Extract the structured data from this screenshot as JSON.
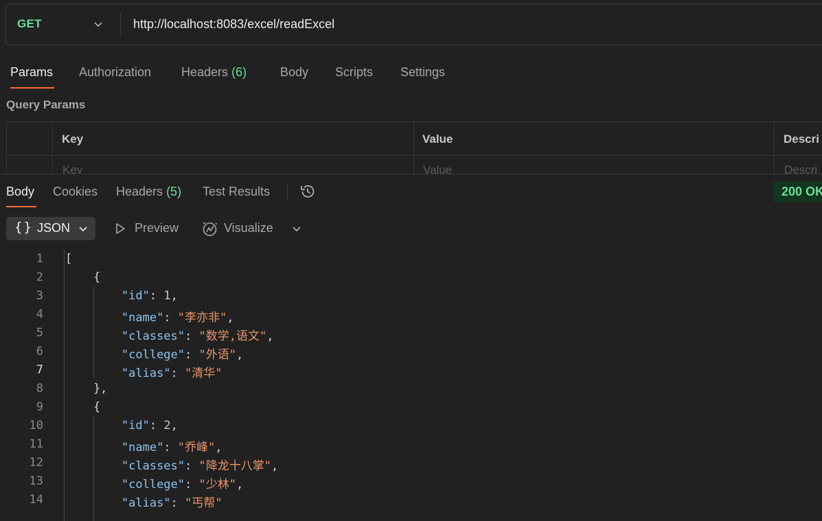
{
  "request": {
    "method": "GET",
    "url": "http://localhost:8083/excel/readExcel"
  },
  "request_tabs": {
    "params": "Params",
    "authorization": "Authorization",
    "headers": "Headers",
    "headers_count": "(6)",
    "body": "Body",
    "scripts": "Scripts",
    "settings": "Settings"
  },
  "query_params": {
    "title": "Query Params",
    "columns": {
      "key": "Key",
      "value": "Value",
      "description": "Descri"
    },
    "placeholders": {
      "key": "Key",
      "value": "Value",
      "description": "Descri"
    }
  },
  "response_tabs": {
    "body": "Body",
    "cookies": "Cookies",
    "headers": "Headers",
    "headers_count": "(5)",
    "test_results": "Test Results"
  },
  "status": {
    "text": "200 OK",
    "color": "#6bdd9a"
  },
  "format_bar": {
    "format_brace": "{}",
    "format_label": "JSON",
    "preview": "Preview",
    "visualize": "Visualize"
  },
  "accent_color": "#ff6c37",
  "response_lines": [
    {
      "n": "1",
      "text": "["
    },
    {
      "n": "2",
      "text": "    {"
    },
    {
      "n": "3",
      "key": "\"id\"",
      "sep": ": ",
      "num": "1",
      "end": ","
    },
    {
      "n": "4",
      "key": "\"name\"",
      "sep": ": ",
      "str": "\"李亦非\"",
      "end": ","
    },
    {
      "n": "5",
      "key": "\"classes\"",
      "sep": ": ",
      "str": "\"数学,语文\"",
      "end": ","
    },
    {
      "n": "6",
      "key": "\"college\"",
      "sep": ": ",
      "str": "\"外语\"",
      "end": ","
    },
    {
      "n": "7",
      "key": "\"alias\"",
      "sep": ": ",
      "str": "\"清华\"",
      "end": ""
    },
    {
      "n": "8",
      "text": "    },"
    },
    {
      "n": "9",
      "text": "    {"
    },
    {
      "n": "10",
      "key": "\"id\"",
      "sep": ": ",
      "num": "2",
      "end": ","
    },
    {
      "n": "11",
      "key": "\"name\"",
      "sep": ": ",
      "str": "\"乔峰\"",
      "end": ","
    },
    {
      "n": "12",
      "key": "\"classes\"",
      "sep": ": ",
      "str": "\"降龙十八掌\"",
      "end": ","
    },
    {
      "n": "13",
      "key": "\"college\"",
      "sep": ": ",
      "str": "\"少林\"",
      "end": ","
    },
    {
      "n": "14",
      "key": "\"alias\"",
      "sep": ": ",
      "str": "\"丐帮\"",
      "end": ""
    }
  ]
}
